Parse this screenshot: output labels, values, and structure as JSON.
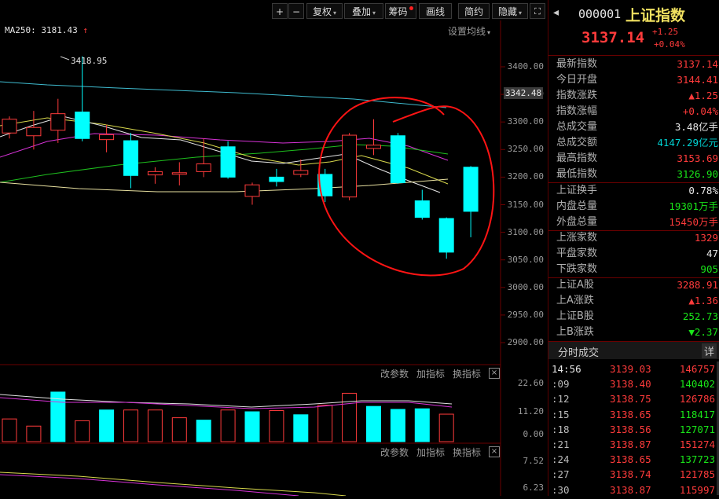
{
  "toolbar": {
    "plus": "+",
    "minus": "−",
    "fuquan": "复权",
    "diejia": "叠加",
    "chouma": "筹码",
    "huaxian": "画线",
    "jianyue": "简约",
    "yincang": "隐藏",
    "fullscreen": "⛶"
  },
  "chart": {
    "ma_label": "MA250: 3181.43",
    "ma_arrow": "↑",
    "settings": "设置均线",
    "high_marker": "3418.95",
    "current_price_tag": "3342.48",
    "y_ticks": [
      "3400.00",
      "3350.00",
      "3300.00",
      "3250.00",
      "3200.00",
      "3150.00",
      "3100.00",
      "3050.00",
      "3000.00",
      "2950.00",
      "2900.00"
    ]
  },
  "chart_data": {
    "type": "candlestick",
    "ylim": [
      2880,
      3440
    ],
    "candles": [
      {
        "o": 3305,
        "c": 3280,
        "h": 3310,
        "l": 3270,
        "dir": "up"
      },
      {
        "o": 3290,
        "c": 3275,
        "h": 3320,
        "l": 3250,
        "dir": "up"
      },
      {
        "o": 3315,
        "c": 3285,
        "h": 3342,
        "l": 3262,
        "dir": "up"
      },
      {
        "o": 3318,
        "c": 3270,
        "h": 3418.95,
        "l": 3265,
        "dir": "down"
      },
      {
        "o": 3277,
        "c": 3268,
        "h": 3295,
        "l": 3245,
        "dir": "up"
      },
      {
        "o": 3266,
        "c": 3203,
        "h": 3280,
        "l": 3180,
        "dir": "down"
      },
      {
        "o": 3210,
        "c": 3204,
        "h": 3218,
        "l": 3188,
        "dir": "up"
      },
      {
        "o": 3208,
        "c": 3207,
        "h": 3227,
        "l": 3185,
        "dir": "up"
      },
      {
        "o": 3224,
        "c": 3210,
        "h": 3270,
        "l": 3200,
        "dir": "up"
      },
      {
        "o": 3255,
        "c": 3200,
        "h": 3265,
        "l": 3197,
        "dir": "down"
      },
      {
        "o": 3186,
        "c": 3165,
        "h": 3190,
        "l": 3150,
        "dir": "up"
      },
      {
        "o": 3200,
        "c": 3192,
        "h": 3215,
        "l": 3183,
        "dir": "down"
      },
      {
        "o": 3212,
        "c": 3205,
        "h": 3232,
        "l": 3200,
        "dir": "up"
      },
      {
        "o": 3205,
        "c": 3166,
        "h": 3215,
        "l": 3155,
        "dir": "down"
      },
      {
        "o": 3276,
        "c": 3164,
        "h": 3280,
        "l": 3158,
        "dir": "up"
      },
      {
        "o": 3258,
        "c": 3252,
        "h": 3305,
        "l": 3240,
        "dir": "up"
      },
      {
        "o": 3275,
        "c": 3190,
        "h": 3280,
        "l": 3188,
        "dir": "down"
      },
      {
        "o": 3157,
        "c": 3127,
        "h": 3177,
        "l": 3123,
        "dir": "down"
      },
      {
        "o": 3125,
        "c": 3064,
        "h": 3127,
        "l": 3052,
        "dir": "down"
      },
      {
        "o": 3218,
        "c": 3138,
        "h": 3220,
        "l": 3091,
        "dir": "down"
      }
    ],
    "volume_ticks": [
      "22.60",
      "11.20",
      "0.00"
    ],
    "volume": [
      {
        "v": 0.38,
        "dir": "up"
      },
      {
        "v": 0.26,
        "dir": "up"
      },
      {
        "v": 0.83,
        "dir": "down"
      },
      {
        "v": 0.35,
        "dir": "up"
      },
      {
        "v": 0.53,
        "dir": "down"
      },
      {
        "v": 0.53,
        "dir": "up"
      },
      {
        "v": 0.53,
        "dir": "up"
      },
      {
        "v": 0.4,
        "dir": "up"
      },
      {
        "v": 0.36,
        "dir": "down"
      },
      {
        "v": 0.53,
        "dir": "up"
      },
      {
        "v": 0.5,
        "dir": "down"
      },
      {
        "v": 0.52,
        "dir": "up"
      },
      {
        "v": 0.45,
        "dir": "down"
      },
      {
        "v": 0.61,
        "dir": "up"
      },
      {
        "v": 0.81,
        "dir": "up"
      },
      {
        "v": 0.59,
        "dir": "down"
      },
      {
        "v": 0.54,
        "dir": "down"
      },
      {
        "v": 0.55,
        "dir": "down"
      },
      {
        "v": 0.46,
        "dir": "up"
      }
    ],
    "indicator_ticks": [
      "7.52",
      "6.23"
    ]
  },
  "sub1": {
    "gai": "改参数",
    "jia": "加指标",
    "huan": "换指标"
  },
  "sub2": {
    "gai": "改参数",
    "jia": "加指标",
    "huan": "换指标"
  },
  "panel": {
    "code": "000001",
    "name": "上证指数",
    "price": "3137.14",
    "change": "+1.25",
    "change_pct": "+0.04%",
    "rows1": [
      {
        "label": "最新指数",
        "value": "3137.14",
        "color": "red"
      },
      {
        "label": "今日开盘",
        "value": "3144.41",
        "color": "red"
      },
      {
        "label": "指数涨跌",
        "value": "▲1.25",
        "color": "red"
      },
      {
        "label": "指数涨幅",
        "value": "+0.04%",
        "color": "red"
      },
      {
        "label": "总成交量",
        "value": "3.48亿手",
        "color": "white"
      },
      {
        "label": "总成交额",
        "value": "4147.29亿元",
        "color": "cyan"
      },
      {
        "label": "最高指数",
        "value": "3153.69",
        "color": "red"
      },
      {
        "label": "最低指数",
        "value": "3126.90",
        "color": "green"
      }
    ],
    "rows2": [
      {
        "label": "上证换手",
        "value": "0.78%",
        "color": "white"
      },
      {
        "label": "内盘总量",
        "value": "19301万手",
        "color": "green"
      },
      {
        "label": "外盘总量",
        "value": "15450万手",
        "color": "red"
      }
    ],
    "rows3": [
      {
        "label": "上涨家数",
        "value": "1329",
        "color": "red"
      },
      {
        "label": "平盘家数",
        "value": "47",
        "color": "white"
      },
      {
        "label": "下跌家数",
        "value": "905",
        "color": "green"
      }
    ],
    "rows4": [
      {
        "label": "上证A股",
        "value": "3288.91",
        "color": "red"
      },
      {
        "label": "上A涨跌",
        "value": "▲1.36",
        "color": "red"
      },
      {
        "label": "上证B股",
        "value": "252.73",
        "color": "green"
      },
      {
        "label": "上B涨跌",
        "value": "▼2.37",
        "color": "green"
      }
    ],
    "ticks_title": "分时成交",
    "ticks_detail": "详",
    "ticks": [
      {
        "t": "14:56",
        "p": "3139.03",
        "v": "146757",
        "c": "red"
      },
      {
        "t": ":09",
        "p": "3138.40",
        "v": "140402",
        "c": "green"
      },
      {
        "t": ":12",
        "p": "3138.75",
        "v": "126786",
        "c": "red"
      },
      {
        "t": ":15",
        "p": "3138.65",
        "v": "118417",
        "c": "green"
      },
      {
        "t": ":18",
        "p": "3138.56",
        "v": "127071",
        "c": "green"
      },
      {
        "t": ":21",
        "p": "3138.87",
        "v": "151274",
        "c": "red"
      },
      {
        "t": ":24",
        "p": "3138.65",
        "v": "137723",
        "c": "green"
      },
      {
        "t": ":27",
        "p": "3138.74",
        "v": "121785",
        "c": "red"
      },
      {
        "t": ":30",
        "p": "3138.87",
        "v": "115997",
        "c": "red"
      }
    ]
  }
}
